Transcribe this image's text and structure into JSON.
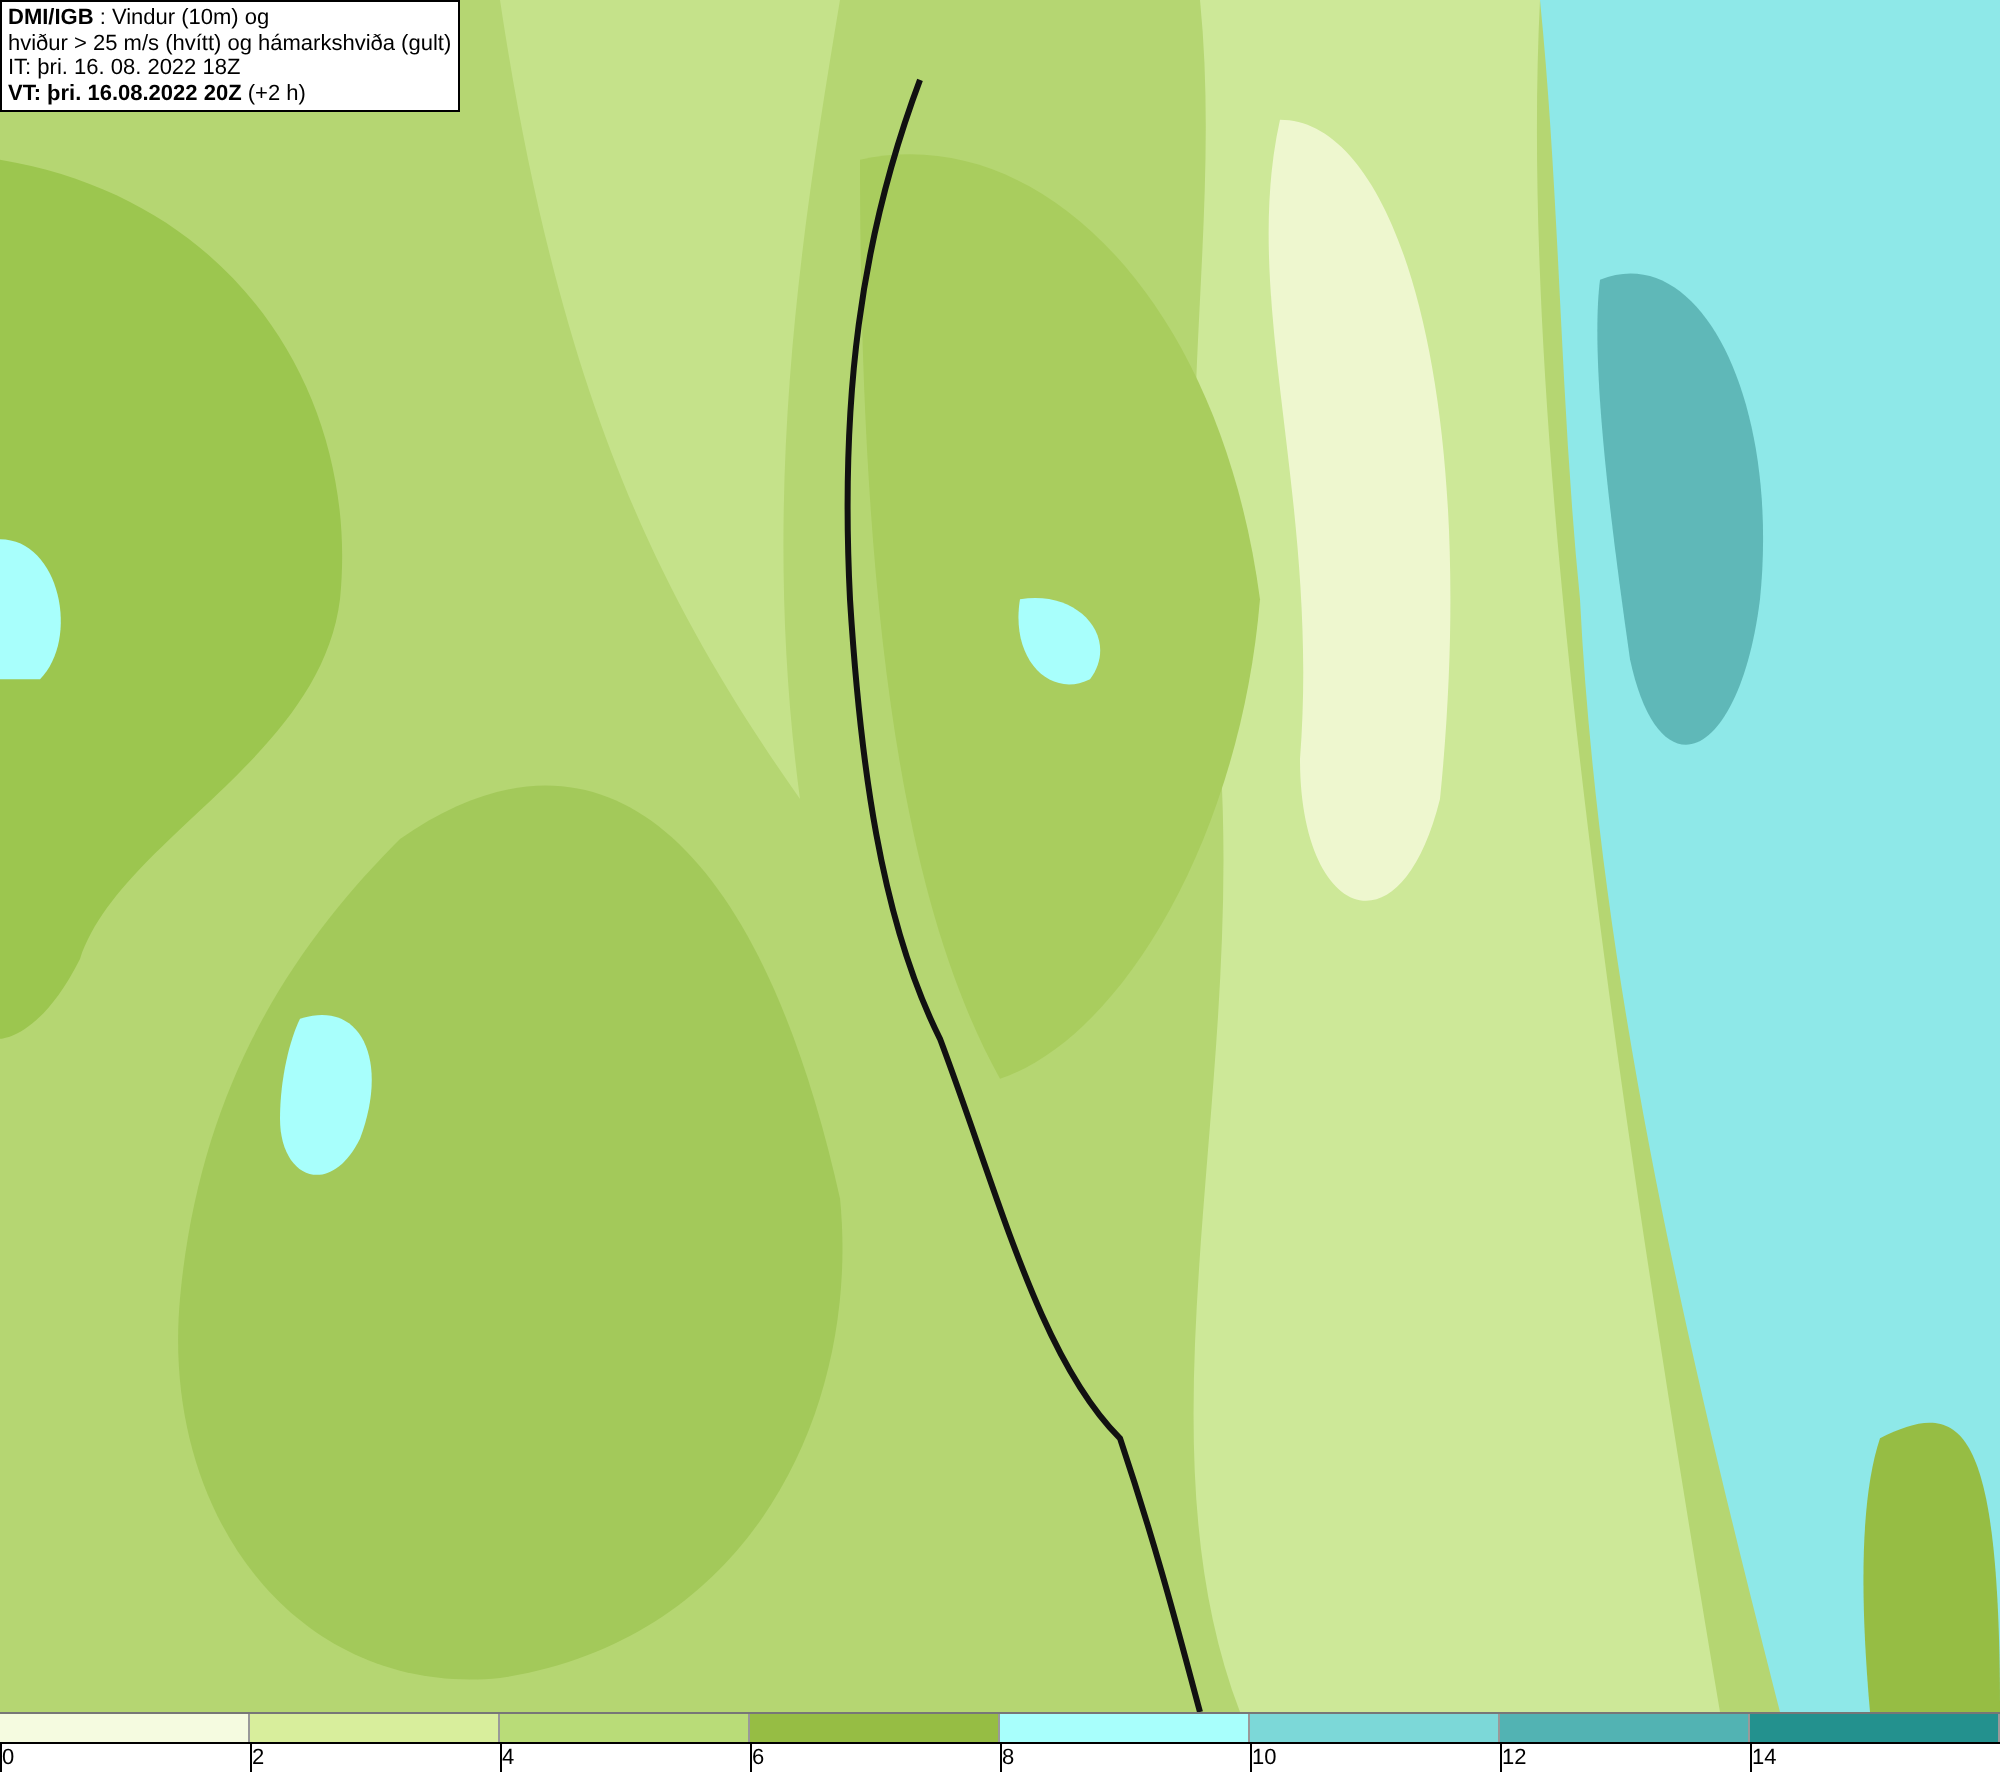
{
  "info_box": {
    "lines": [
      "**DMI/IGB** : Vindur (10m) og",
      "hviður > 25 m/s (hvítt) og hámarkshviða (gult)",
      "IT: þri. 16. 08. 2022 18Z",
      "**VT: þri. 16.08.2022 20Z** (+2 h)"
    ]
  },
  "legend": [
    {
      "label": "0",
      "color": "#f5fbe0"
    },
    {
      "label": "2",
      "color": "#d8ee9c"
    },
    {
      "label": "4",
      "color": "#b9dc78"
    },
    {
      "label": "6",
      "color": "#96bd44"
    },
    {
      "label": "8",
      "color": "#a8fffc"
    },
    {
      "label": "10",
      "color": "#7cd8d8"
    },
    {
      "label": "12",
      "color": "#52b3b3"
    },
    {
      "label": "14",
      "color": "#23918e"
    }
  ]
}
